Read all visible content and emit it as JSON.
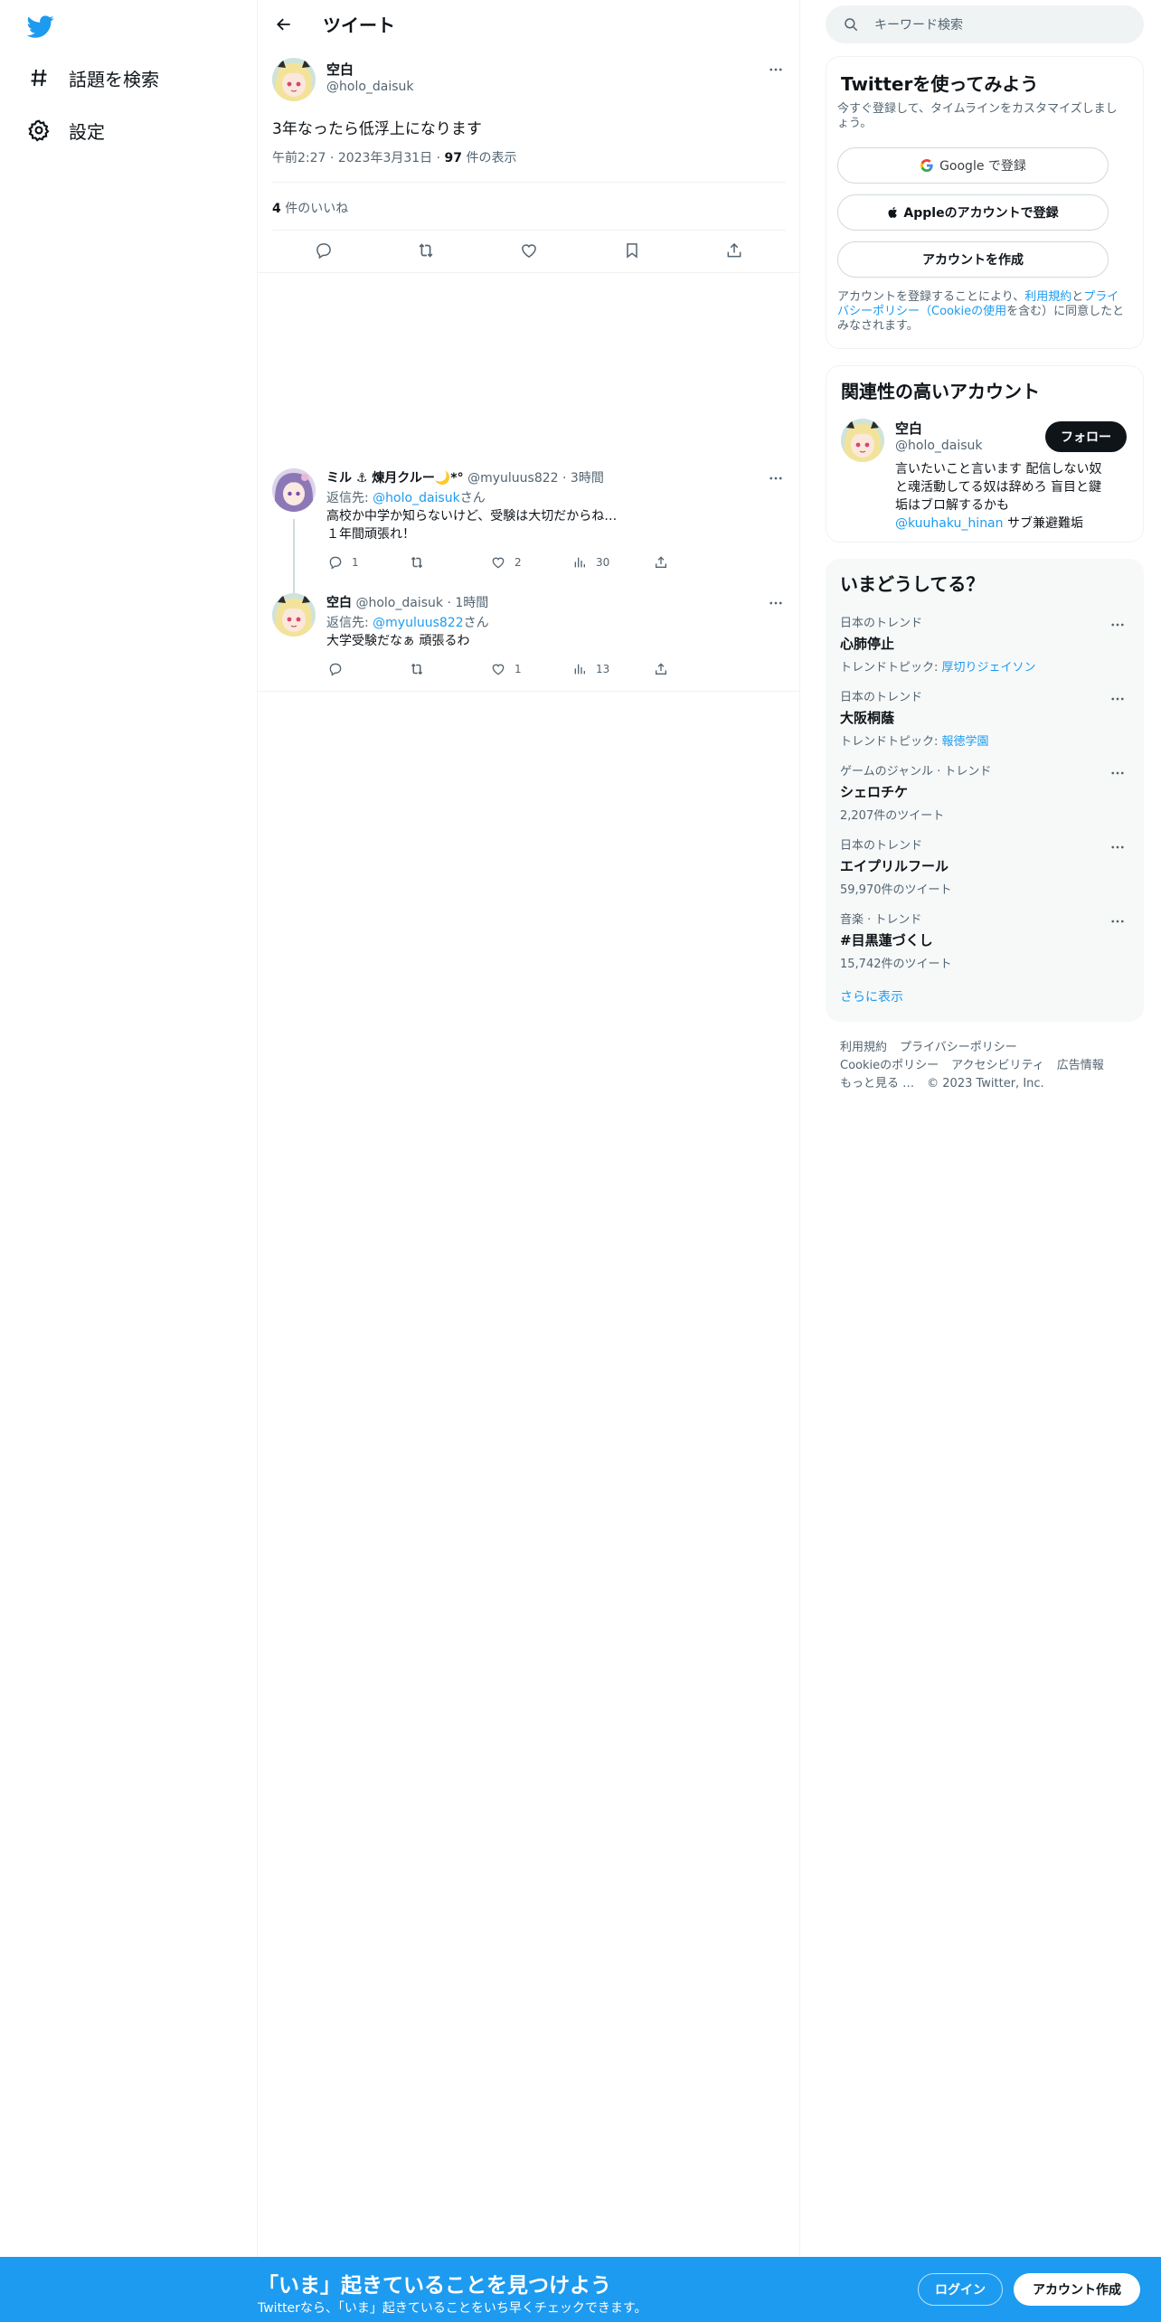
{
  "nav": {
    "logo_icon": "twitter-bird-icon",
    "brand_color": "#1d9bf0",
    "items": [
      {
        "label": "話題を検索",
        "icon": "hashtag-icon"
      },
      {
        "label": "設定",
        "icon": "gear-icon"
      }
    ]
  },
  "header": {
    "title": "ツイート"
  },
  "tweet": {
    "name": "空白",
    "handle": "@holo_daisuk",
    "text": "3年なったら低浮上になります",
    "time": "午前2:27",
    "date": "2023年3月31日",
    "views_count": "97",
    "views_label": "件の表示",
    "likes_count": "4",
    "likes_label": "件のいいね"
  },
  "replies": [
    {
      "name": "ミル ⚓ 煉月クルー🌙*°",
      "handle": "@myuluus822",
      "time": "3時間",
      "reply_prefix": "返信先: ",
      "reply_to": "@holo_daisuk",
      "reply_suffix": "さん",
      "text_line1": "高校か中学か知らないけど、受験は大切だからね…",
      "text_line2": "１年間頑張れ！",
      "stats": {
        "reply": "1",
        "retweet": "",
        "like": "2",
        "views": "30"
      }
    },
    {
      "name": "空白",
      "handle": "@holo_daisuk",
      "time": "1時間",
      "reply_prefix": "返信先: ",
      "reply_to": "@myuluus822",
      "reply_suffix": "さん",
      "text_line1": "大学受験だなぁ 頑張るわ",
      "stats": {
        "reply": "",
        "retweet": "",
        "like": "1",
        "views": "13"
      }
    }
  ],
  "search": {
    "placeholder": "キーワード検索"
  },
  "signup": {
    "title": "Twitterを使ってみよう",
    "subtitle": "今すぐ登録して、タイムラインをカスタマイズしましょう。",
    "google_label": "Google で登録",
    "apple_label": "Appleのアカウントで登録",
    "create_label": "アカウントを作成",
    "legal_prefix": "アカウントを登録することにより、",
    "legal_terms": "利用規約",
    "legal_and": "と",
    "legal_privacy": "プライバシーポリシー（Cookieの使用",
    "legal_suffix": "を含む）に同意したとみなされます。"
  },
  "related": {
    "title": "関連性の高いアカウント",
    "name": "空白",
    "handle": "@holo_daisuk",
    "follow_label": "フォロー",
    "bio_line1": "言いたいこと言います 配信しない奴",
    "bio_line2": "と魂活動してる奴は辞めろ 盲目と鍵",
    "bio_line3": "垢はブロ解するかも",
    "bio_mention": "@kuuhaku_hinan",
    "bio_tail": " サブ兼避難垢"
  },
  "trends": {
    "title": "いまどうしてる？",
    "items": [
      {
        "context": "日本のトレンド",
        "name": "心肺停止",
        "sub_prefix": "トレンドトピック: ",
        "sub_link": "厚切りジェイソン"
      },
      {
        "context": "日本のトレンド",
        "name": "大阪桐蔭",
        "sub_prefix": "トレンドトピック: ",
        "sub_link": "報徳学園"
      },
      {
        "context": "ゲームのジャンル · トレンド",
        "name": "シェロチケ",
        "sub_prefix": "2,207件のツイート",
        "sub_link": ""
      },
      {
        "context": "日本のトレンド",
        "name": "エイプリルフール",
        "sub_prefix": "59,970件のツイート",
        "sub_link": ""
      },
      {
        "context": "音楽 · トレンド",
        "name": "#目黒蓮づくし",
        "sub_prefix": "15,742件のツイート",
        "sub_link": ""
      }
    ],
    "show_more": "さらに表示"
  },
  "footer": {
    "terms": "利用規約",
    "privacy": "プライバシーポリシー",
    "cookie": "Cookieのポリシー",
    "accessibility": "アクセシビリティ",
    "ads": "広告情報",
    "more": "もっと見る …",
    "copyright": "© 2023 Twitter, Inc."
  },
  "bottom_bar": {
    "title": "「いま」起きていることを見つけよう",
    "subtitle": "Twitterなら、「いま」起きていることをいち早くチェックできます。",
    "login_label": "ログイン",
    "signup_label": "アカウント作成"
  }
}
